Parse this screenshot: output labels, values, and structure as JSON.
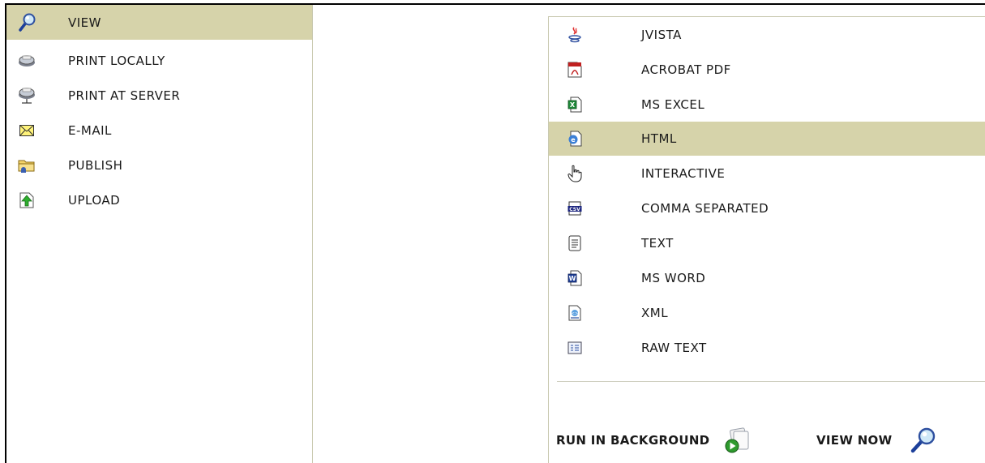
{
  "left_menu": {
    "items": [
      {
        "label": "VIEW",
        "icon": "magnifier-icon",
        "selected": true
      },
      {
        "label": "PRINT LOCALLY",
        "icon": "printer-icon",
        "selected": false
      },
      {
        "label": "PRINT AT SERVER",
        "icon": "network-printer-icon",
        "selected": false
      },
      {
        "label": "E-MAIL",
        "icon": "envelope-icon",
        "selected": false
      },
      {
        "label": "PUBLISH",
        "icon": "folder-icon",
        "selected": false
      },
      {
        "label": "UPLOAD",
        "icon": "upload-icon",
        "selected": false
      }
    ]
  },
  "formats": {
    "items": [
      {
        "label": "JVISTA",
        "icon": "java-icon",
        "selected": false
      },
      {
        "label": "ACROBAT PDF",
        "icon": "pdf-icon",
        "selected": false
      },
      {
        "label": "MS EXCEL",
        "icon": "excel-icon",
        "selected": false
      },
      {
        "label": "HTML",
        "icon": "html-icon",
        "selected": true
      },
      {
        "label": "INTERACTIVE",
        "icon": "hand-pointer-icon",
        "selected": false
      },
      {
        "label": "COMMA SEPARATED",
        "icon": "csv-icon",
        "selected": false
      },
      {
        "label": "TEXT",
        "icon": "text-document-icon",
        "selected": false
      },
      {
        "label": "MS WORD",
        "icon": "word-icon",
        "selected": false
      },
      {
        "label": "XML",
        "icon": "xml-icon",
        "selected": false
      },
      {
        "label": "RAW TEXT",
        "icon": "raw-text-icon",
        "selected": false
      }
    ]
  },
  "actions": {
    "run_background": "RUN IN BACKGROUND",
    "view_now": "VIEW NOW"
  },
  "colors": {
    "selected_bg": "#d6d3aa",
    "divider": "#cfcfc0"
  }
}
